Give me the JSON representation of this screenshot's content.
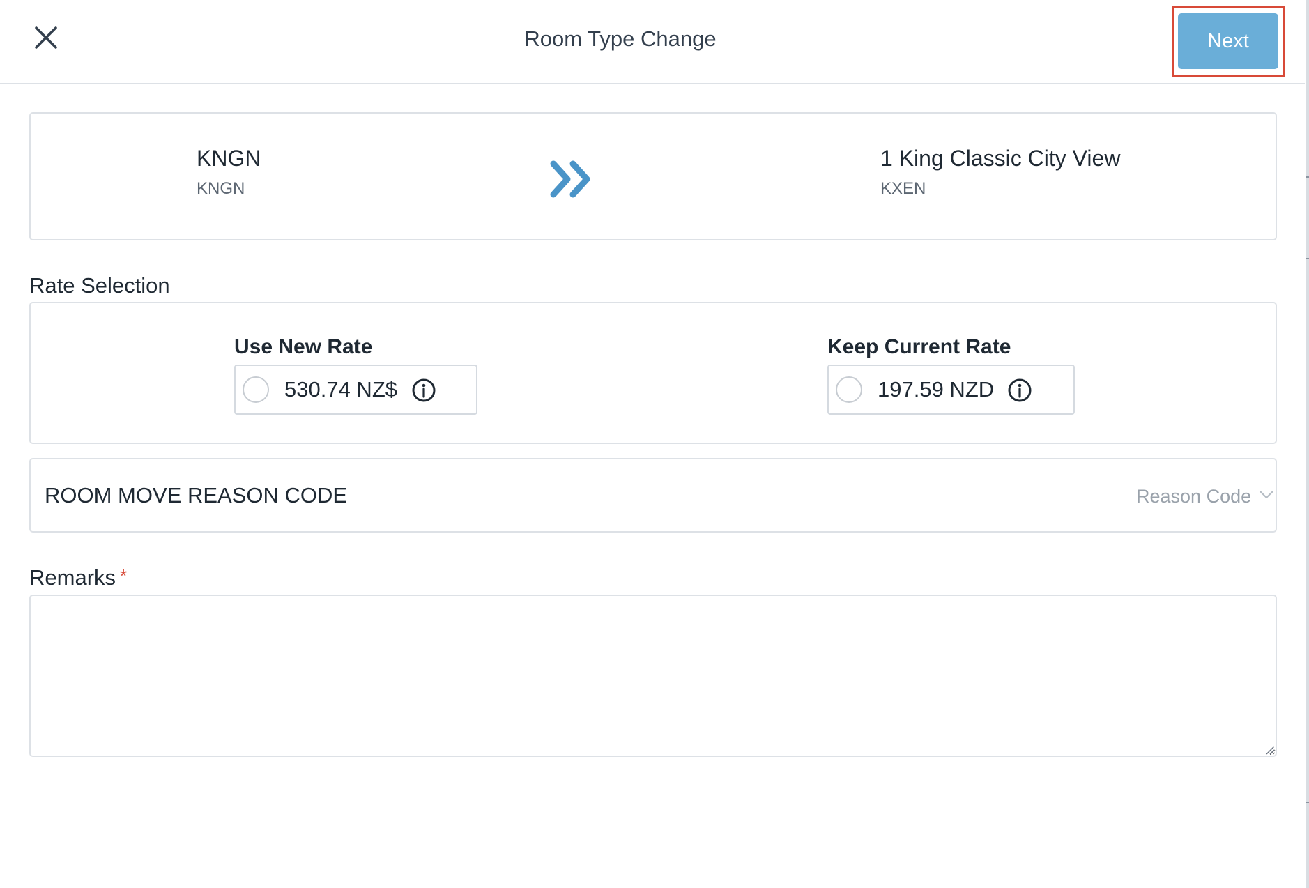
{
  "dialog": {
    "title": "Room Type Change",
    "next_label": "Next",
    "icons": {
      "close": "close-icon",
      "transfer": "double-chevron-right-icon",
      "info": "info-circle-icon",
      "dropdown": "chevron-down-icon"
    }
  },
  "room_change": {
    "from": {
      "name": "KNGN",
      "code": "KNGN"
    },
    "to": {
      "name": "1 King Classic City View",
      "code": "KXEN"
    }
  },
  "rate_selection": {
    "label": "Rate Selection",
    "new_rate": {
      "heading": "Use New Rate",
      "value": "530.74 NZ$",
      "selected": false
    },
    "current_rate": {
      "heading": "Keep Current Rate",
      "value": "197.59 NZD",
      "selected": false
    }
  },
  "reason": {
    "label": "ROOM MOVE REASON CODE",
    "placeholder": "Reason Code"
  },
  "remarks": {
    "label": "Remarks",
    "required_marker": "*",
    "value": ""
  },
  "colors": {
    "accent": "#6aaed8",
    "arrow": "#4a94c8",
    "highlight_outline": "#d84a38",
    "required": "#d84a38",
    "border": "#dde1e6"
  }
}
